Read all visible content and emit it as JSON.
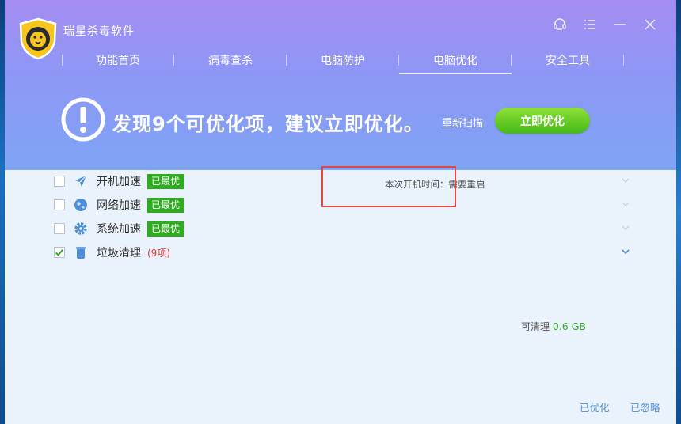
{
  "app": {
    "title": "瑞星杀毒软件"
  },
  "nav": {
    "tabs": [
      {
        "label": "功能首页"
      },
      {
        "label": "病毒查杀"
      },
      {
        "label": "电脑防护"
      },
      {
        "label": "电脑优化",
        "active": true
      },
      {
        "label": "安全工具"
      }
    ]
  },
  "banner": {
    "headline": "发现9个可优化项，建议立即优化。",
    "rescan_label": "重新扫描",
    "optimize_label": "立即优化"
  },
  "items": [
    {
      "label": "开机加速",
      "badge": "已最优",
      "checked": false,
      "icon": "paper-plane-icon",
      "info": "本次开机时间：需要重启"
    },
    {
      "label": "网络加速",
      "badge": "已最优",
      "checked": false,
      "icon": "globe-icon"
    },
    {
      "label": "系统加速",
      "badge": "已最优",
      "checked": false,
      "icon": "gear-icon"
    },
    {
      "label": "垃圾清理",
      "count": "(9项)",
      "checked": true,
      "icon": "trash-can-icon",
      "cleanable_label": "可清理",
      "cleanable_size": "0.6 GB"
    }
  ],
  "footer": {
    "optimized_label": "已优化",
    "ignored_label": "已忽略"
  },
  "colors": {
    "header_top": "#a58cf2",
    "header_bottom": "#7ea4f5",
    "badge_green": "#2eab1f",
    "button_green": "#46b916",
    "link_blue": "#4d8fd6",
    "highlight_red": "#e54545"
  }
}
